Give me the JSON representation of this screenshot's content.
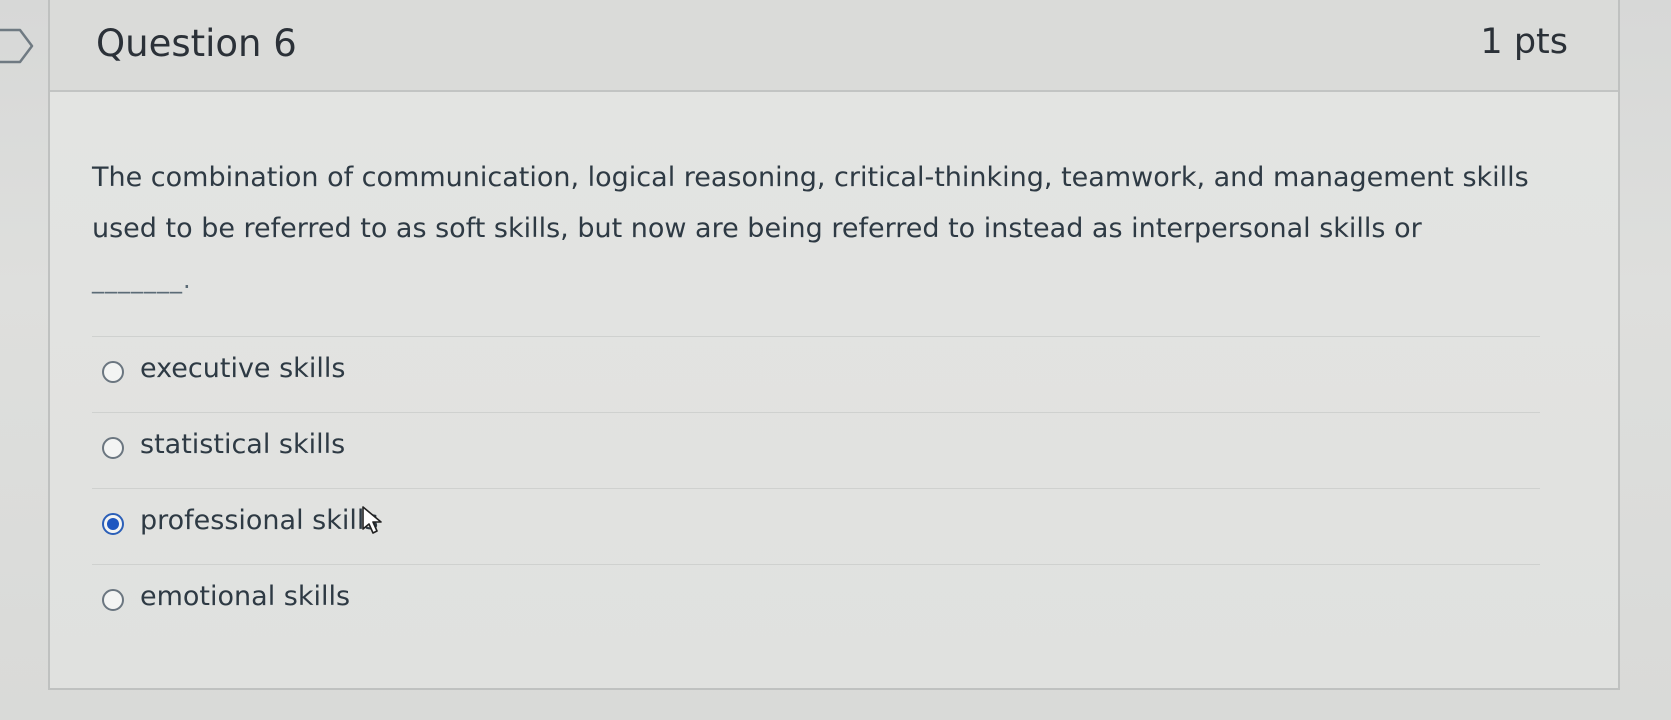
{
  "question": {
    "title": "Question 6",
    "points": "1 pts",
    "text": "The combination of communication, logical reasoning, critical-thinking, teamwork, and management skills used to be referred to as soft skills, but now are being referred to instead as interpersonal skills or",
    "blank": "_______."
  },
  "answers": [
    {
      "label": "executive skills",
      "selected": false
    },
    {
      "label": "statistical skills",
      "selected": false
    },
    {
      "label": "professional skills",
      "selected": true
    },
    {
      "label": "emotional skills",
      "selected": false
    }
  ],
  "colors": {
    "selected_radio": "#1e57c0",
    "text": "#2e3a44"
  },
  "icons": {
    "flag": "flag-outline-icon",
    "cursor": "pointer-cursor-icon"
  }
}
